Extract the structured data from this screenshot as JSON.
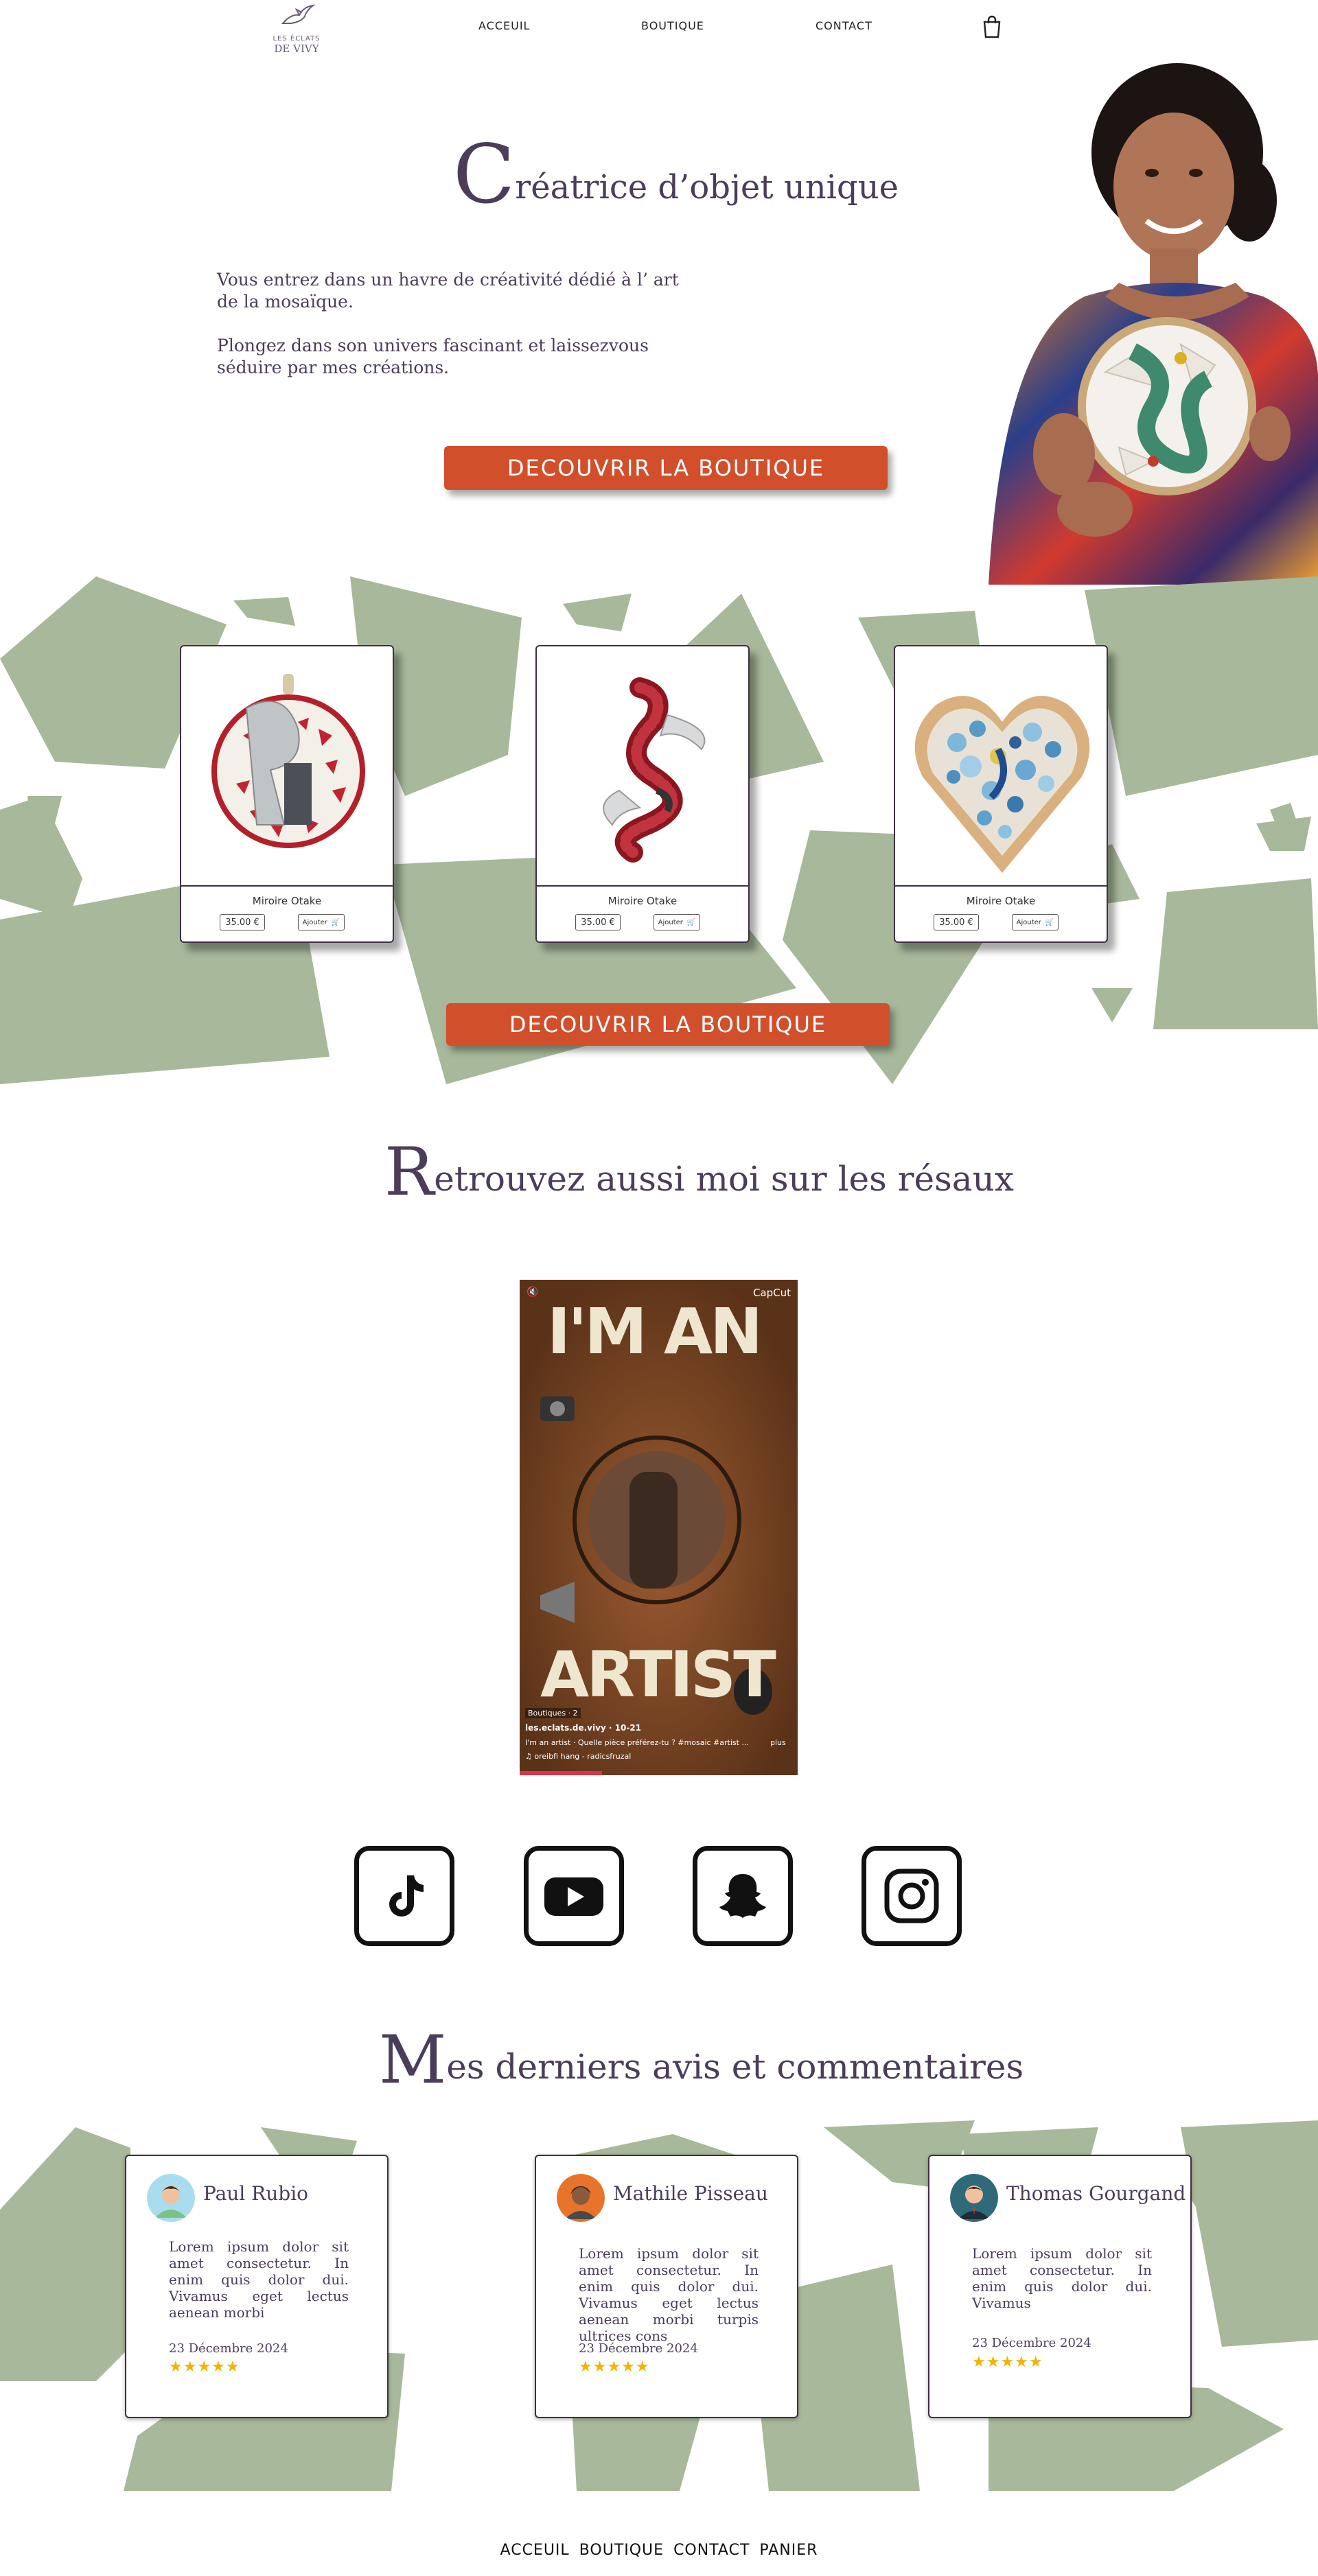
{
  "nav": {
    "logo_line1": "LES ÉCLATS",
    "logo_line2": "DE VIVY",
    "links": [
      "ACCEUIL",
      "BOUTIQUE",
      "CONTACT"
    ]
  },
  "hero": {
    "title_cap": "C",
    "title_rest": "réatrice d’objet unique",
    "para1": "Vous entrez dans un havre de créativité dédié à l’ art de la mosaïque.",
    "para2": "Plongez dans son univers fascinant et laissezvous séduire par mes créations.",
    "cta": "DECOUVRIR LA BOUTIQUE"
  },
  "products": [
    {
      "name": "Miroire Otake",
      "price": "35.00 €",
      "add": "Ajouter"
    },
    {
      "name": "Miroire Otake",
      "price": "35.00 €",
      "add": "Ajouter"
    },
    {
      "name": "Miroire Otake",
      "price": "35.00 €",
      "add": "Ajouter"
    }
  ],
  "products_cta": "DECOUVRIR LA BOUTIQUE",
  "social_section": {
    "title_cap": "R",
    "title_rest": "etrouvez aussi moi sur les résaux"
  },
  "video": {
    "brand": "CapCut",
    "big1": "I'M AN",
    "big2": "ARTIST",
    "user": "les.eclats.de.vivy · 10-21",
    "caption": "I'm an artist · Quelle pièce préférez-tu ? #mosaic #artist ...",
    "more": "plus",
    "sound": "♫ oreibfi hang - radicsfruzal",
    "tag": "Boutiques · 2"
  },
  "reviews_section": {
    "title_cap": "M",
    "title_rest": "es derniers avis et commentaires"
  },
  "reviews": [
    {
      "name": "Paul Rubio",
      "text": "Lorem ipsum dolor sit amet consectetur. In enim quis dolor dui. Vivamus eget lectus aenean morbi",
      "date": "23 Décembre 2024",
      "stars": "★★★★★"
    },
    {
      "name": "Mathile Pisseau",
      "text": "Lorem ipsum dolor sit amet consectetur. In enim quis dolor dui. Vivamus eget lectus aenean morbi turpis ultrices cons",
      "date": "23 Décembre 2024",
      "stars": "★★★★★"
    },
    {
      "name": "Thomas Gourgand",
      "text": "Lorem ipsum dolor sit amet consectetur. In enim quis dolor dui. Vivamus",
      "date": "23 Décembre 2024",
      "stars": "★★★★★"
    }
  ],
  "footer": {
    "links": [
      "ACCEUIL",
      "BOUTIQUE",
      "CONTACT",
      "PANIER"
    ]
  },
  "colors": {
    "accent": "#d24f2c",
    "text": "#4b3d5a",
    "shape": "#a8b89a"
  }
}
